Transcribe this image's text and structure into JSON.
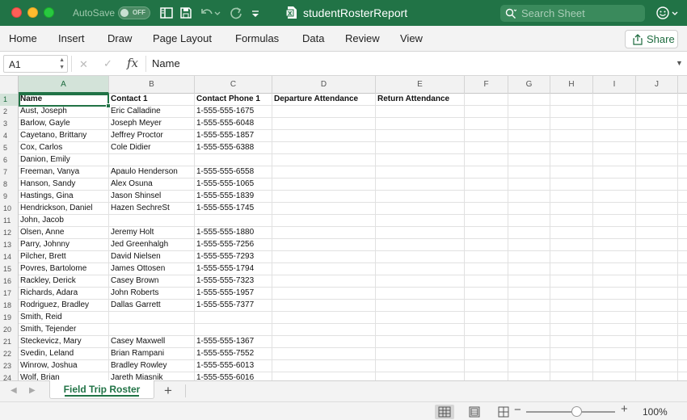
{
  "titlebar": {
    "autosave_label": "AutoSave",
    "autosave_state": "OFF",
    "title": "studentRosterReport",
    "search_placeholder": "Search Sheet",
    "accent_color": "#217346"
  },
  "ribbon": {
    "tabs": [
      "Home",
      "Insert",
      "Draw",
      "Page Layout",
      "Formulas",
      "Data",
      "Review",
      "View"
    ],
    "share_label": "Share"
  },
  "formula_bar": {
    "name_box": "A1",
    "fx_label": "fx",
    "formula": "Name"
  },
  "sheet": {
    "selected_cell": "A1",
    "columns": [
      "A",
      "B",
      "C",
      "D",
      "E",
      "F",
      "G",
      "H",
      "I",
      "J"
    ],
    "headers": [
      "Name",
      "Contact 1",
      "Contact Phone 1",
      "Departure Attendance",
      "Return Attendance"
    ],
    "rows": [
      [
        "Aust, Joseph",
        "Eric Calladine",
        "1-555-555-1675"
      ],
      [
        "Barlow, Gayle",
        "Joseph Meyer",
        "1-555-555-6048"
      ],
      [
        "Cayetano, Brittany",
        "Jeffrey Proctor",
        "1-555-555-1857"
      ],
      [
        "Cox, Carlos",
        "Cole Didier",
        "1-555-555-6388"
      ],
      [
        "Danion, Emily",
        "",
        ""
      ],
      [
        "Freeman, Vanya",
        "Apaulo Henderson",
        "1-555-555-6558"
      ],
      [
        "Hanson, Sandy",
        "Alex Osuna",
        "1-555-555-1065"
      ],
      [
        "Hastings, Gina",
        "Jason Shinsel",
        "1-555-555-1839"
      ],
      [
        "Hendrickson, Daniel",
        "Hazen SechreSt",
        "1-555-555-1745"
      ],
      [
        "John, Jacob",
        "",
        ""
      ],
      [
        "Olsen, Anne",
        "Jeremy Holt",
        "1-555-555-1880"
      ],
      [
        "Parry, Johnny",
        "Jed Greenhalgh",
        "1-555-555-7256"
      ],
      [
        "Pilcher, Brett",
        "David Nielsen",
        "1-555-555-7293"
      ],
      [
        "Povres, Bartolome",
        "James Ottosen",
        "1-555-555-1794"
      ],
      [
        "Rackley, Derick",
        "Casey Brown",
        "1-555-555-7323"
      ],
      [
        "Richards, Adara",
        "John Roberts",
        "1-555-555-1957"
      ],
      [
        "Rodriguez, Bradley",
        "Dallas Garrett",
        "1-555-555-7377"
      ],
      [
        "Smith, Reid",
        "",
        ""
      ],
      [
        "Smith, Tejender",
        "",
        ""
      ],
      [
        "Steckevicz, Mary",
        "Casey Maxwell",
        "1-555-555-1367"
      ],
      [
        "Svedin, Leland",
        "Brian Rampani",
        "1-555-555-7552"
      ],
      [
        "Winrow, Joshua",
        "Bradley Rowley",
        "1-555-555-6013"
      ],
      [
        "Wolf, Brian",
        "Jareth Miasnik",
        "1-555-555-6016"
      ]
    ]
  },
  "sheet_tabs": {
    "active": "Field Trip Roster"
  },
  "status": {
    "zoom": "100%"
  }
}
